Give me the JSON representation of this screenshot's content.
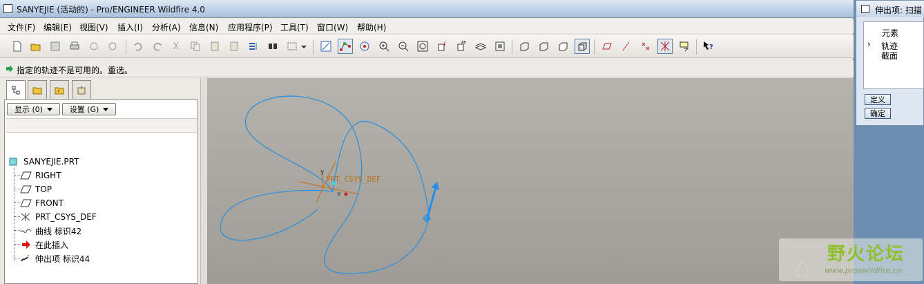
{
  "window": {
    "title": "SANYEJIE (活动的) - Pro/ENGINEER Wildfire 4.0"
  },
  "menu": [
    "文件(F)",
    "编辑(E)",
    "视图(V)",
    "插入(I)",
    "分析(A)",
    "信息(N)",
    "应用程序(P)",
    "工具(T)",
    "窗口(W)",
    "帮助(H)"
  ],
  "message": {
    "text": "指定的轨迹不是可用的。重选。"
  },
  "navigator": {
    "show_button": "显示 (0)",
    "settings_button": "设置 (G)",
    "tree": [
      {
        "label": "SANYEJIE.PRT",
        "icon": "part-icon"
      },
      {
        "label": "RIGHT",
        "icon": "datum-plane-icon"
      },
      {
        "label": "TOP",
        "icon": "datum-plane-icon"
      },
      {
        "label": "FRONT",
        "icon": "datum-plane-icon"
      },
      {
        "label": "PRT_CSYS_DEF",
        "icon": "csys-icon"
      },
      {
        "label": "曲线 标识42",
        "icon": "curve-icon"
      },
      {
        "label": "在此插入",
        "icon": "insert-here-arrow-icon"
      },
      {
        "label": "伸出项 标识44",
        "icon": "sweep-protrusion-icon"
      }
    ]
  },
  "graphics": {
    "csys_label": "PRT_CSYS_DEF",
    "axis_y": "y",
    "axis_x": "x",
    "curve_color": "#2f8fe0"
  },
  "dialog": {
    "title": "伸出项: 扫描",
    "header": "元素",
    "elements": [
      "轨迹",
      "截面"
    ],
    "define_button": "定义",
    "ok_button": "确定"
  },
  "watermark": {
    "name": "野火论坛",
    "url": "www.proewildfire.cn"
  }
}
